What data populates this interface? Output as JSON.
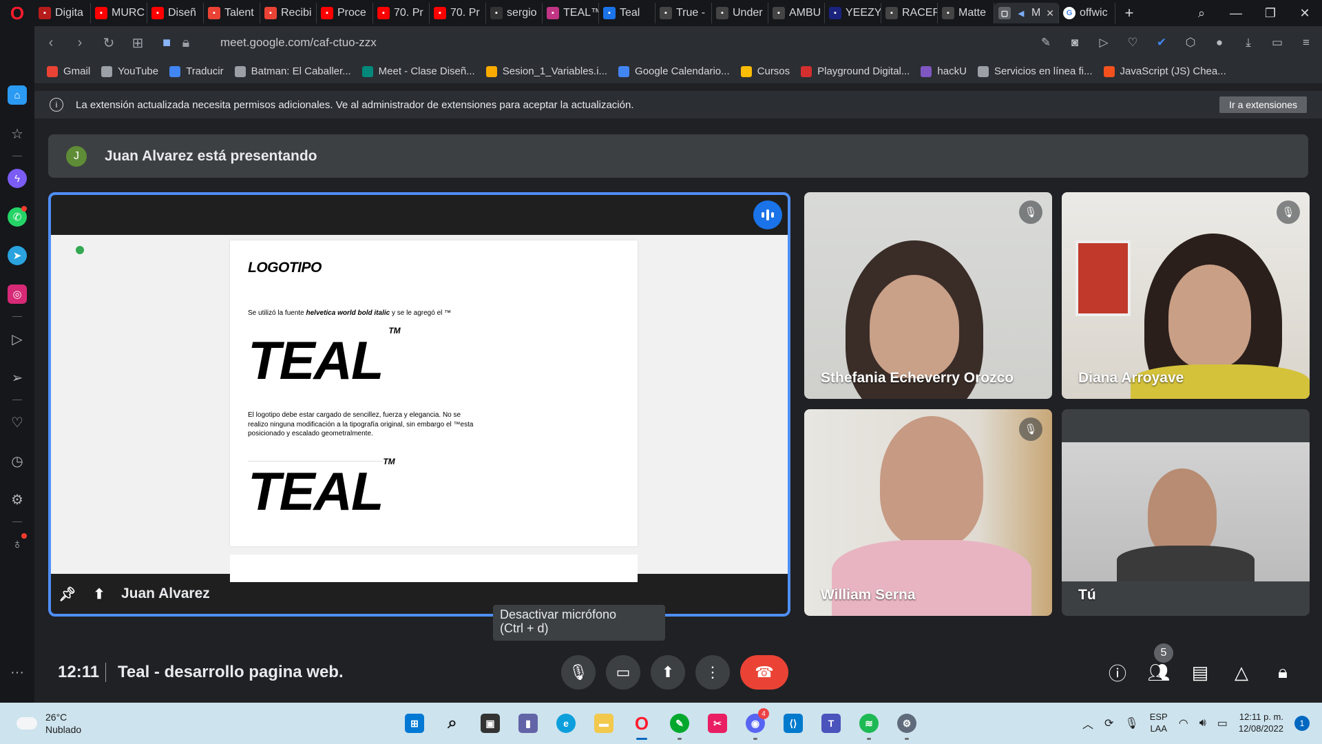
{
  "browser": {
    "tabs": [
      {
        "label": "Digita",
        "color": "#b71c1c",
        "icon": "opera-gx-icon"
      },
      {
        "label": "MURC",
        "color": "#ff0000",
        "icon": "youtube-icon"
      },
      {
        "label": "Diseñ",
        "color": "#ff0000",
        "icon": "youtube-icon"
      },
      {
        "label": "Talent",
        "color": "#ea4335",
        "icon": "gmail-icon"
      },
      {
        "label": "Recibi",
        "color": "#ea4335",
        "icon": "gmail-icon"
      },
      {
        "label": "Proce",
        "color": "#ff0000",
        "icon": "youtube-icon"
      },
      {
        "label": "70. Pr",
        "color": "#ff0000",
        "icon": "youtube-icon"
      },
      {
        "label": "70. Pr",
        "color": "#ff0000",
        "icon": "youtube-icon"
      },
      {
        "label": "sergio",
        "color": "#333333",
        "icon": "github-icon"
      },
      {
        "label": "TEAL™",
        "color": "#c13584",
        "icon": "instagram-icon"
      },
      {
        "label": "Teal",
        "color": "#1a73e8",
        "icon": "store-icon"
      },
      {
        "label": "True -",
        "color": "#444444",
        "icon": "flag-icon"
      },
      {
        "label": "Under",
        "color": "#444444",
        "icon": "swoosh-icon"
      },
      {
        "label": "AMBU",
        "color": "#444444",
        "icon": "ambush-icon"
      },
      {
        "label": "YEEZY",
        "color": "#1a237e",
        "icon": "yeezy-icon"
      },
      {
        "label": "RACER",
        "color": "#444444",
        "icon": "racer-icon"
      },
      {
        "label": "Matte",
        "color": "#444444",
        "icon": "hand-icon"
      }
    ],
    "active_tab": {
      "label": "M",
      "icon": "speaker-icon"
    },
    "after_tab": {
      "label": "offwic",
      "color": "#4285f4",
      "icon": "google-icon"
    },
    "url": "meet.google.com/caf-ctuo-zzx",
    "bookmarks": [
      {
        "label": "Gmail",
        "color": "#ea4335",
        "icon": "gmail-icon"
      },
      {
        "label": "YouTube",
        "color": "#9aa0a6",
        "icon": "page-icon"
      },
      {
        "label": "Traducir",
        "color": "#4285f4",
        "icon": "translate-icon"
      },
      {
        "label": "Batman: El Caballer...",
        "color": "#9aa0a6",
        "icon": "film-icon"
      },
      {
        "label": "Meet - Clase Diseñ...",
        "color": "#00897b",
        "icon": "meet-icon"
      },
      {
        "label": "Sesion_1_Variables.i...",
        "color": "#f9ab00",
        "icon": "colab-icon"
      },
      {
        "label": "Google Calendario...",
        "color": "#4285f4",
        "icon": "calendar-icon"
      },
      {
        "label": "Cursos",
        "color": "#fbbc04",
        "icon": "pencil-icon"
      },
      {
        "label": "Playground Digital...",
        "color": "#d32f2f",
        "icon": "chevron-right-icon"
      },
      {
        "label": "hackU",
        "color": "#7e57c2",
        "icon": "u-icon"
      },
      {
        "label": "Servicios en línea fi...",
        "color": "#9aa0a6",
        "icon": "page-icon"
      },
      {
        "label": "JavaScript (JS) Chea...",
        "color": "#f4511e",
        "icon": "shield-icon"
      }
    ],
    "infobar": {
      "message": "La extensión actualizada necesita permisos adicionales. Ve al administrador de extensiones para aceptar la actualización.",
      "button": "Ir a extensiones"
    }
  },
  "meet": {
    "presenting_banner": "Juan Alvarez está presentando",
    "presenter_initial": "J",
    "presenter_name": "Juan Alvarez",
    "document": {
      "heading": "LOGOTIPO",
      "line1_pre": "Se utilizó la fuente ",
      "line1_bold": "helvetica world bold italic",
      "line1_post": " y se le agregó el ™",
      "logo_text": "TEAL",
      "tm": "TM",
      "paragraph": "El logotipo debe estar cargado de sencillez, fuerza y elegancia. No se realizo ninguna modificación a la tipografía original, sin embargo el ™esta posicionado y escalado geometralmente."
    },
    "participants": [
      {
        "name": "Sthefania Echeverry Orozco",
        "muted": true
      },
      {
        "name": "Diana Arroyave",
        "muted": true
      },
      {
        "name": "William Serna",
        "muted": true
      },
      {
        "name": "Tú",
        "muted": false
      }
    ],
    "tooltip_line1": "Desactivar micrófono",
    "tooltip_line2": "(Ctrl + d)",
    "time": "12:11",
    "meeting_title": "Teal - desarrollo pagina web.",
    "people_count": "5"
  },
  "taskbar": {
    "weather_temp": "26°C",
    "weather_desc": "Nublado",
    "language_line1": "ESP",
    "language_line2": "LAA",
    "clock_time": "12:11 p. m.",
    "clock_date": "12/08/2022",
    "notification_count": "1",
    "discord_badge": "4"
  }
}
